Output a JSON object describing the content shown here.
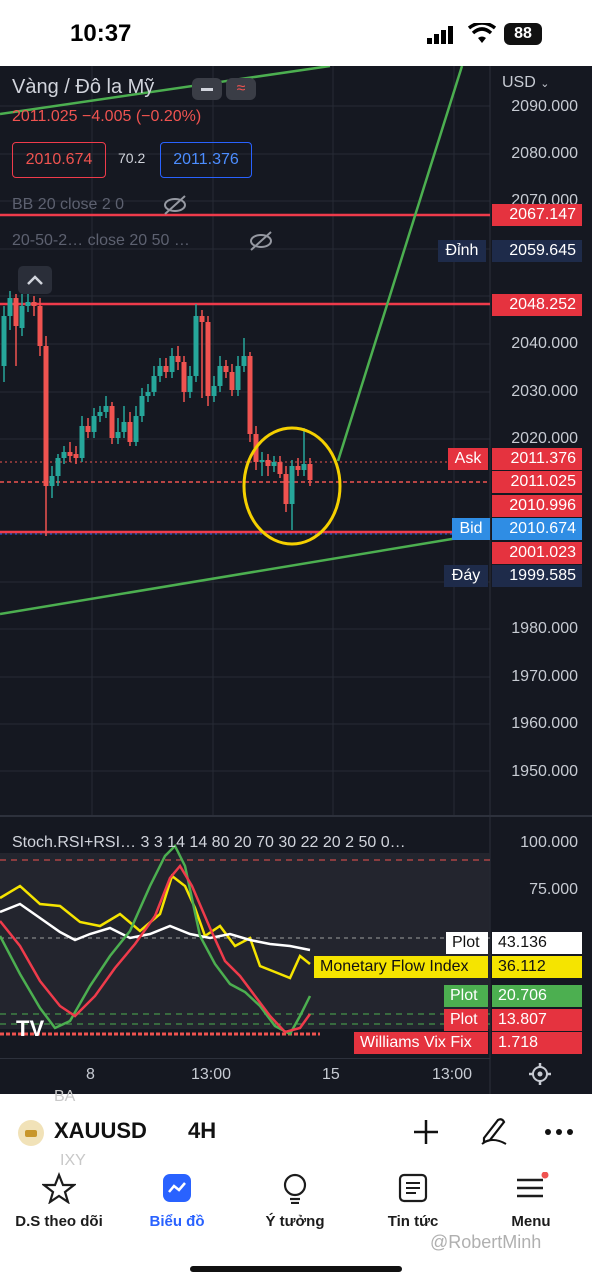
{
  "status_bar": {
    "time": "10:37",
    "battery": "88"
  },
  "chart": {
    "symbol_title": "Vàng / Đô la Mỹ",
    "quote": "2011.025  −4.005 (−0.20%)",
    "bid_box": "2010.674",
    "spread": "70.2",
    "ask_box": "2011.376",
    "indicator_bb": "BB 20 close 2 0",
    "indicator_ma": "20-50-2…   close 20 50 …",
    "currency": "USD",
    "price_ticks": [
      "2090.000",
      "2080.000",
      "2070.000",
      "2040.000",
      "2030.000",
      "2020.000",
      "1980.000",
      "1970.000",
      "1960.000",
      "1950.000"
    ],
    "price_labels": {
      "l1": "2067.147",
      "dinh_tag": "Đỉnh",
      "dinh": "2059.645",
      "l2": "2048.252",
      "ask_tag": "Ask",
      "ask": "2011.376",
      "last": "2011.025",
      "l3": "2010.996",
      "bid_tag": "Bid",
      "bid": "2010.674",
      "l4": "2001.023",
      "day_tag": "Đáy",
      "day": "1999.585"
    },
    "time_ticks": [
      "8",
      "13:00",
      "15",
      "13:00"
    ],
    "colors": {
      "up": "#26a69a",
      "down": "#ef5350",
      "accent": "#2962ff",
      "trend": "#4caf50",
      "circle": "#f5d000"
    }
  },
  "oscillator": {
    "title": "Stoch.RSI+RSI…  3 3 14 14 80 20 70 30 22 20 2 50 0…",
    "ticks": [
      "100.000",
      "75.000"
    ],
    "plot1_label": "Plot",
    "plot1_value": "43.136",
    "mfi_label": "Monetary Flow Index",
    "mfi_value": "36.112",
    "plot2_label": "Plot",
    "plot2_value": "20.706",
    "plot3_label": "Plot",
    "plot3_value": "13.807",
    "wvf_label": "Williams Vix Fix",
    "wvf_value": "1.718"
  },
  "symbol_bar": {
    "symbol": "XAUUSD",
    "timeframe": "4H",
    "ghost_top": "BA",
    "ghost_bottom": "IXY"
  },
  "tabs": [
    {
      "label": "D.S theo dõi",
      "icon": "star-icon"
    },
    {
      "label": "Biểu đồ",
      "icon": "chart-icon"
    },
    {
      "label": "Ý tưởng",
      "icon": "lightbulb-icon"
    },
    {
      "label": "Tin tức",
      "icon": "news-icon"
    },
    {
      "label": "Menu",
      "icon": "menu-icon"
    }
  ],
  "watermark": "@RobertMinh"
}
